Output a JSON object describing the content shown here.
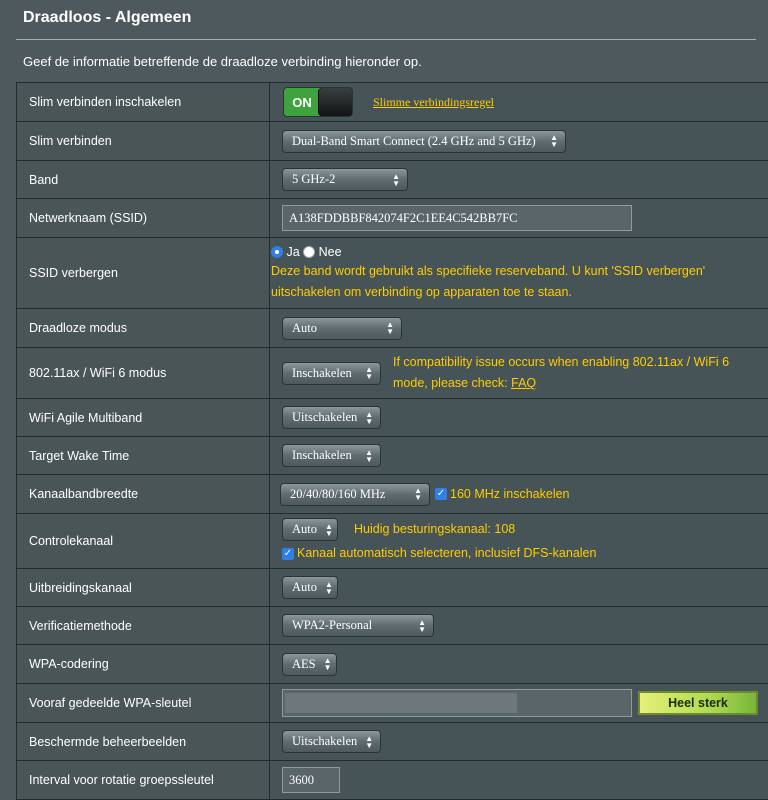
{
  "header": {
    "title": "Draadloos - Algemeen",
    "intro": "Geef de informatie betreffende de draadloze verbinding hieronder op."
  },
  "rows": {
    "smart_connect_enable": {
      "label": "Slim verbinden inschakelen",
      "toggle_text": "ON",
      "link": "Slimme verbindingsregel"
    },
    "smart_connect": {
      "label": "Slim verbinden",
      "value": "Dual-Band Smart Connect (2.4 GHz and 5 GHz)"
    },
    "band": {
      "label": "Band",
      "value": "5 GHz-2"
    },
    "ssid": {
      "label": "Netwerknaam (SSID)",
      "value": "A138FDDBBF842074F2C1EE4C542BB7FC"
    },
    "hide_ssid": {
      "label": "SSID verbergen",
      "opt_yes": "Ja",
      "opt_no": "Nee",
      "note_line1": "Deze band wordt gebruikt als specifieke reserveband. U kunt 'SSID verbergen'",
      "note_line2": "uitschakelen om verbinding op apparaten toe te staan."
    },
    "wireless_mode": {
      "label": "Draadloze modus",
      "value": "Auto"
    },
    "wifi6_mode": {
      "label": "802.11ax / WiFi 6 modus",
      "value": "Inschakelen",
      "note_line1": "If compatibility issue occurs when enabling 802.11ax / WiFi 6",
      "note_line2_prefix": "mode, please check: ",
      "note_link": "FAQ"
    },
    "agile_multiband": {
      "label": "WiFi Agile Multiband",
      "value": "Uitschakelen"
    },
    "target_wake_time": {
      "label": "Target Wake Time",
      "value": "Inschakelen"
    },
    "channel_bandwidth": {
      "label": "Kanaalbandbreedte",
      "value": "20/40/80/160 MHz",
      "checkbox_label": "160 MHz inschakelen"
    },
    "control_channel": {
      "label": "Controlekanaal",
      "value": "Auto",
      "current": "Huidig besturingskanaal: 108",
      "checkbox_label": "Kanaal automatisch selecteren, inclusief DFS-kanalen"
    },
    "extension_channel": {
      "label": "Uitbreidingskanaal",
      "value": "Auto"
    },
    "auth_method": {
      "label": "Verificatiemethode",
      "value": "WPA2-Personal"
    },
    "wpa_encryption": {
      "label": "WPA-codering",
      "value": "AES"
    },
    "wpa_key": {
      "label": "Vooraf gedeelde WPA-sleutel",
      "strength": "Heel sterk"
    },
    "pmf": {
      "label": "Beschermde beheerbeelden",
      "value": "Uitschakelen"
    },
    "group_key_interval": {
      "label": "Interval voor rotatie groepssleutel",
      "value": "3600"
    }
  },
  "colors": {
    "background": "#4d595d",
    "accent_yellow": "#ffcc00",
    "toggle_on": "#3fa33d",
    "checkbox_blue": "#2f7fe6"
  }
}
